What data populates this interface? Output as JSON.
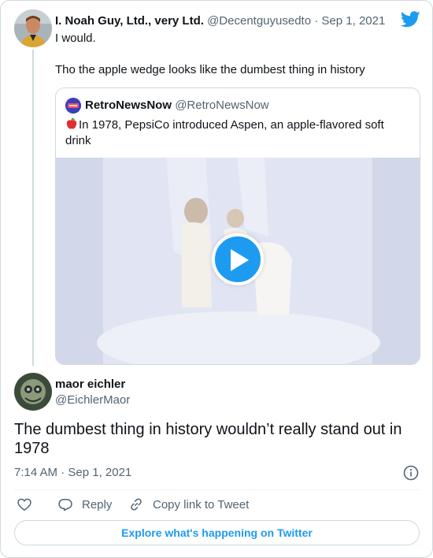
{
  "parent_tweet": {
    "display_name": "I. Noah Guy, Ltd., very Ltd.",
    "handle": "@Decentguyusedto",
    "separator": "·",
    "date": "Sep 1, 2021",
    "text_line1": "I would.",
    "text_line2": "Tho the apple wedge looks like the dumbest thing in history"
  },
  "quoted_tweet": {
    "display_name": "RetroNewsNow",
    "handle": "@RetroNewsNow",
    "text": "In 1978, PepsiCo introduced Aspen, an apple-flavored soft drink"
  },
  "reply_tweet": {
    "display_name": "maor eichler",
    "handle": "@EichlerMaor",
    "text": "The dumbest thing in history wouldn’t really stand out in 1978",
    "timestamp": "7:14 AM · Sep 1, 2021"
  },
  "actions": {
    "reply_label": "Reply",
    "copy_label": "Copy link to Tweet"
  },
  "explore_label": "Explore what's happening on Twitter",
  "colors": {
    "accent": "#1d9bf0",
    "text": "#0f1419",
    "muted": "#536471",
    "border": "#cfd9de"
  },
  "icons": [
    "twitter-bird-icon",
    "apple-emoji-icon",
    "play-icon",
    "info-icon",
    "heart-icon",
    "reply-icon",
    "link-icon"
  ]
}
